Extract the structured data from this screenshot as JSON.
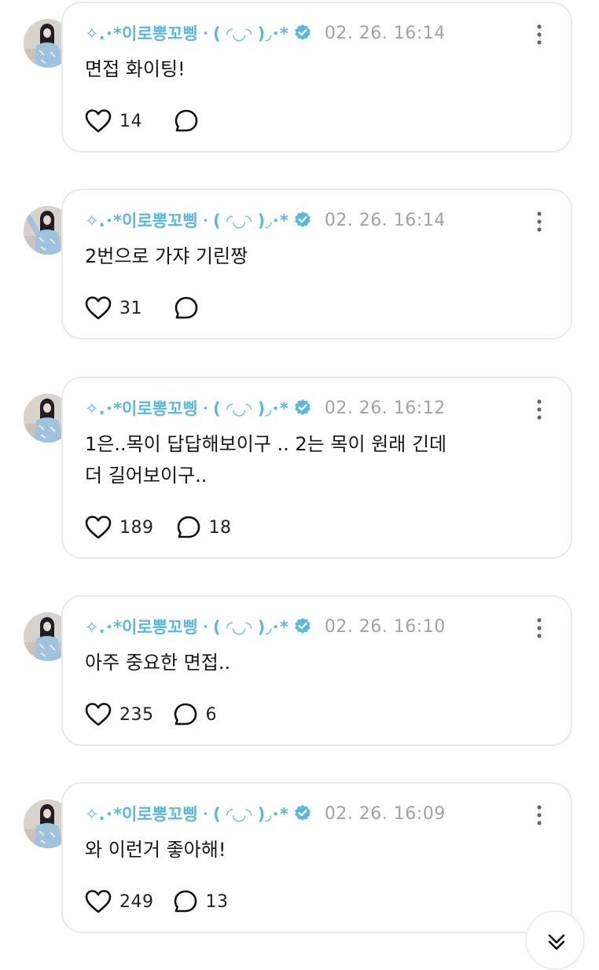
{
  "feed": {
    "posts": [
      {
        "username": "✧.･*이로뽕꼬삥ㆍ( ◜◡◝ )◞･*",
        "timestamp": "02. 26. 16:14",
        "content": "면접 화이팅!",
        "likes": "14",
        "replies": ""
      },
      {
        "username": "✧.･*이로뽕꼬삥ㆍ( ◜◡◝ )◞･*",
        "timestamp": "02. 26. 16:14",
        "content": "2번으로 가쟈 기린짱",
        "likes": "31",
        "replies": ""
      },
      {
        "username": "✧.･*이로뽕꼬삥ㆍ( ◜◡◝ )◞･*",
        "timestamp": "02. 26. 16:12",
        "content": "1은..목이 답답해보이구 .. 2는 목이 원래 긴데\n더 길어보이구..",
        "likes": "189",
        "replies": "18"
      },
      {
        "username": "✧.･*이로뽕꼬삥ㆍ( ◜◡◝ )◞･*",
        "timestamp": "02. 26. 16:10",
        "content": "아주 중요한 면접..",
        "likes": "235",
        "replies": "6"
      },
      {
        "username": "✧.･*이로뽕꼬삥ㆍ( ◜◡◝ )◞･*",
        "timestamp": "02. 26. 16:09",
        "content": "와 이런거 좋아해!",
        "likes": "249",
        "replies": "13"
      }
    ]
  },
  "icons": {
    "verified": "verified-badge-icon",
    "more": "more-options-icon",
    "like": "heart-icon",
    "reply": "speech-bubble-icon",
    "scroll": "chevron-down-icon"
  },
  "colors": {
    "username": "#5cb8d8",
    "verified": "#5cb8d8",
    "timestamp": "#a2a2a2",
    "card_border": "#e9e9e9"
  }
}
